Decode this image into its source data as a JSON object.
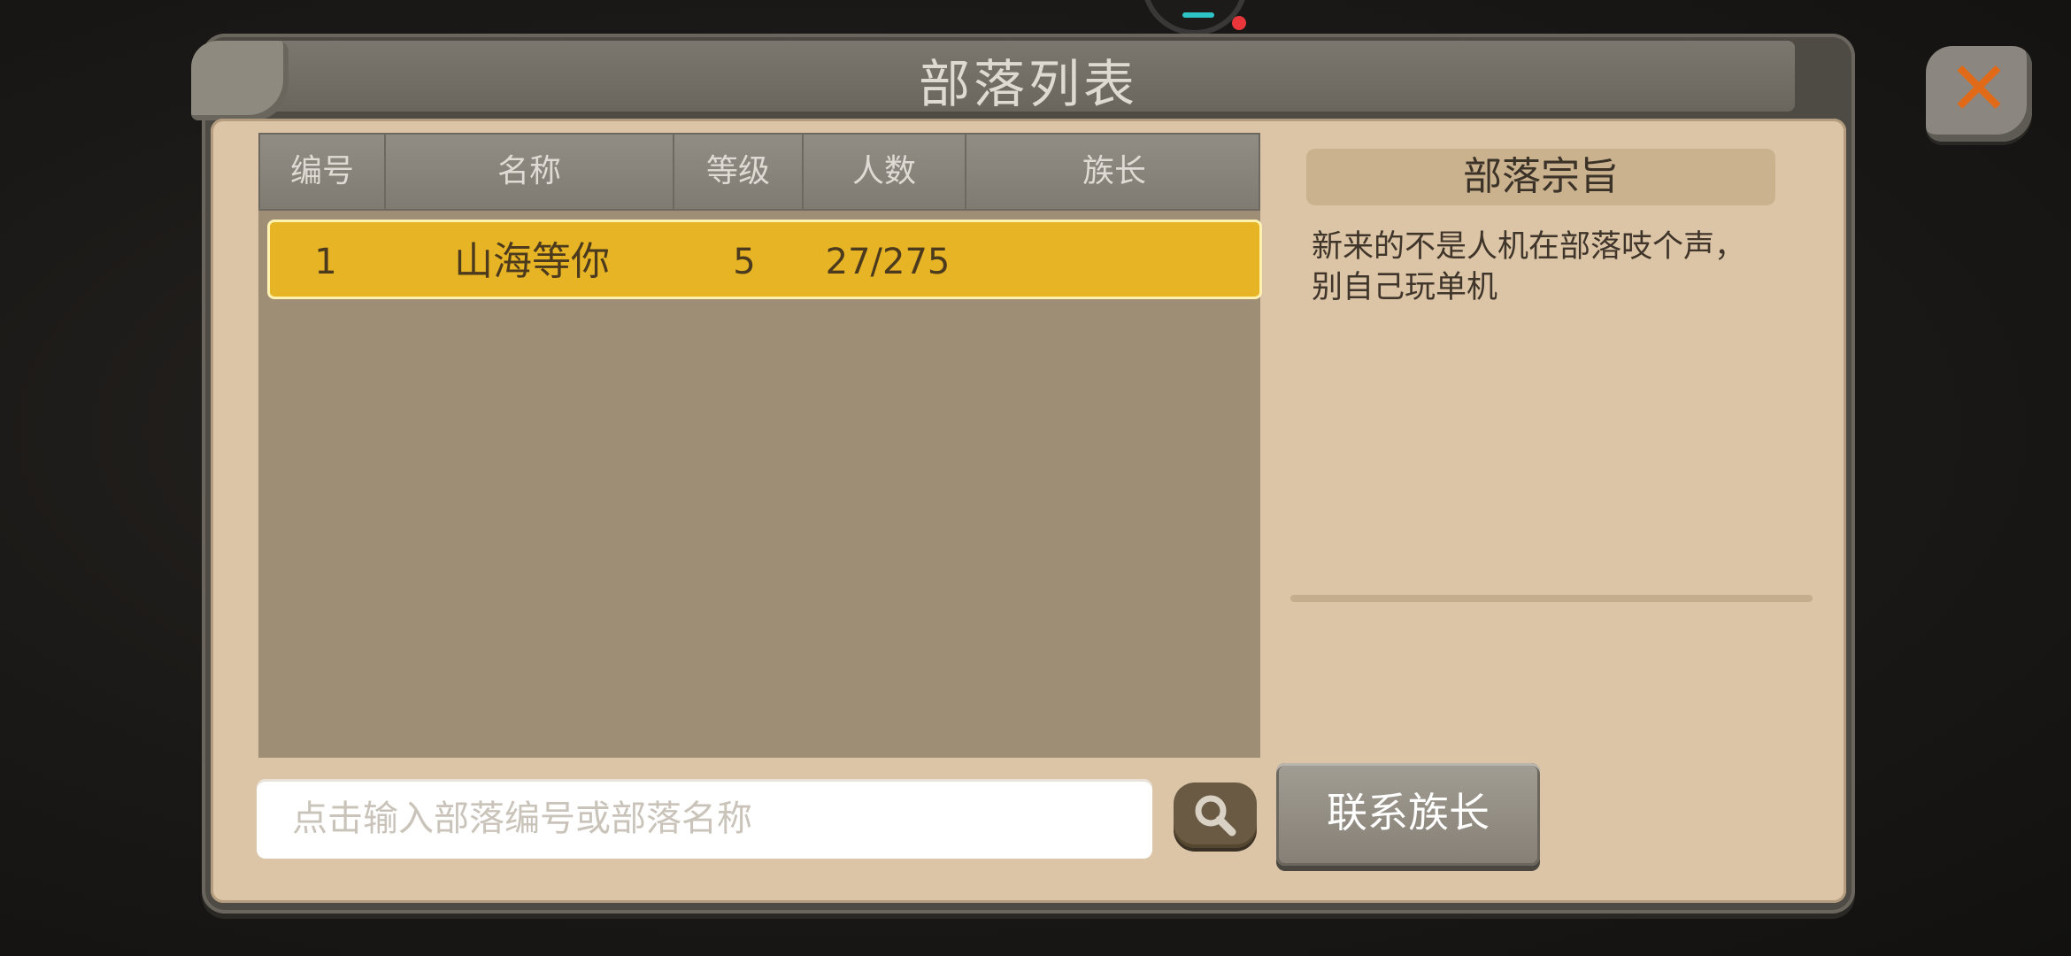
{
  "dialog": {
    "title": "部落列表",
    "close_icon": "close-x-icon",
    "accent_color": "#e6b424"
  },
  "table": {
    "headers": [
      "编号",
      "名称",
      "等级",
      "人数",
      "族长"
    ],
    "rows": [
      {
        "id": "1",
        "name": "山海等你",
        "level": "5",
        "members": "27/275",
        "leader": ""
      }
    ],
    "selected_row": 0
  },
  "purpose": {
    "title": "部落宗旨",
    "text": "新来的不是人机在部落吱个声，\n别自己玩单机"
  },
  "search": {
    "placeholder": "点击输入部落编号或部落名称",
    "value": "",
    "button_icon": "search-icon"
  },
  "contact_button": {
    "label": "联系族长"
  }
}
